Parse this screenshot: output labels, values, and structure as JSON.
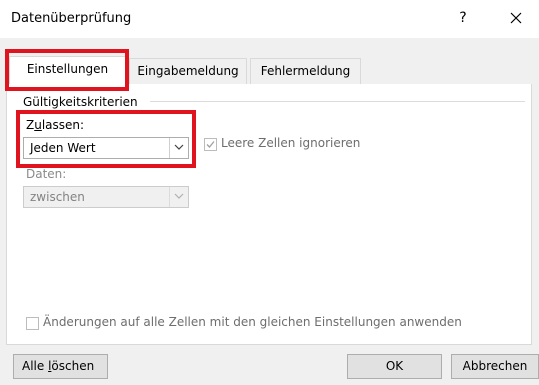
{
  "window": {
    "title": "Datenüberprüfung",
    "help_label": "?",
    "close_label": "✕"
  },
  "tabs": [
    {
      "label": "Einstellungen",
      "active": true
    },
    {
      "label": "Eingabemeldung",
      "active": false
    },
    {
      "label": "Fehlermeldung",
      "active": false
    }
  ],
  "settings": {
    "group_label": "Gültigkeitskriterien",
    "zulassen_label_prefix": "Z",
    "zulassen_label_underlined": "u",
    "zulassen_label_suffix": "lassen:",
    "zulassen_value": "Jeden Wert",
    "leere_zellen_label": "Leere Zellen ignorieren",
    "leere_zellen_checked": true,
    "daten_label": "Daten:",
    "daten_value": "zwischen",
    "aenderungen_label": "Änderungen auf alle Zellen mit den gleichen Einstellungen anwenden",
    "aenderungen_checked": false
  },
  "buttons": {
    "clear_prefix": "Alle ",
    "clear_underlined": "l",
    "clear_suffix": "öschen",
    "ok": "OK",
    "cancel": "Abbrechen"
  },
  "colors": {
    "highlight": "#e0141e",
    "disabled_text": "#6d6d6d"
  },
  "icons": [
    "help-icon",
    "close-icon",
    "chevron-down-icon",
    "checkmark-icon"
  ]
}
